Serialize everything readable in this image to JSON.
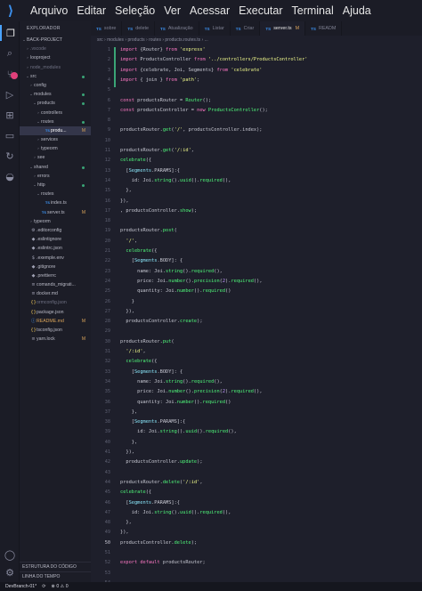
{
  "menu": [
    "Arquivo",
    "Editar",
    "Seleção",
    "Ver",
    "Acessar",
    "Executar",
    "Terminal",
    "Ajuda"
  ],
  "sidebar": {
    "title": "EXPLORADOR",
    "tree": [
      {
        "indent": 0,
        "twist": "⌄",
        "icon": "",
        "label": "BACK-PROJECT",
        "cls": "",
        "dec": ""
      },
      {
        "indent": 1,
        "twist": "›",
        "icon": "",
        "label": ".vscode",
        "cls": "dim",
        "dec": ""
      },
      {
        "indent": 1,
        "twist": "›",
        "icon": "",
        "label": "looproject",
        "cls": "",
        "dec": ""
      },
      {
        "indent": 1,
        "twist": "›",
        "icon": "",
        "label": "node_modules",
        "cls": "dim",
        "dec": ""
      },
      {
        "indent": 1,
        "twist": "⌄",
        "icon": "",
        "label": "src",
        "cls": "",
        "dec": "dot"
      },
      {
        "indent": 2,
        "twist": "›",
        "icon": "",
        "label": "config",
        "cls": "",
        "dec": ""
      },
      {
        "indent": 2,
        "twist": "⌄",
        "icon": "",
        "label": "modules",
        "cls": "",
        "dec": "dot"
      },
      {
        "indent": 3,
        "twist": "⌄",
        "icon": "",
        "label": "products",
        "cls": "",
        "dec": "dot"
      },
      {
        "indent": 4,
        "twist": "›",
        "icon": "",
        "label": "controllers",
        "cls": "",
        "dec": ""
      },
      {
        "indent": 4,
        "twist": "⌄",
        "icon": "",
        "label": "routes",
        "cls": "",
        "dec": "dot"
      },
      {
        "indent": 5,
        "twist": "",
        "icon": "TS",
        "label": "produ...",
        "cls": "sel",
        "dec": "M"
      },
      {
        "indent": 4,
        "twist": "›",
        "icon": "",
        "label": "services",
        "cls": "",
        "dec": ""
      },
      {
        "indent": 4,
        "twist": "›",
        "icon": "",
        "label": "typeorm",
        "cls": "",
        "dec": ""
      },
      {
        "indent": 3,
        "twist": "›",
        "icon": "",
        "label": "see",
        "cls": "",
        "dec": ""
      },
      {
        "indent": 2,
        "twist": "⌄",
        "icon": "",
        "label": "shared",
        "cls": "",
        "dec": "dot"
      },
      {
        "indent": 3,
        "twist": "›",
        "icon": "",
        "label": "errors",
        "cls": "",
        "dec": ""
      },
      {
        "indent": 3,
        "twist": "⌄",
        "icon": "",
        "label": "http",
        "cls": "",
        "dec": "dot"
      },
      {
        "indent": 4,
        "twist": "⌄",
        "icon": "",
        "label": "routes",
        "cls": "",
        "dec": ""
      },
      {
        "indent": 5,
        "twist": "",
        "icon": "TS",
        "label": "index.ts",
        "cls": "",
        "dec": ""
      },
      {
        "indent": 4,
        "twist": "",
        "icon": "TS",
        "label": "server.ts",
        "cls": "",
        "dec": "M"
      },
      {
        "indent": 2,
        "twist": "›",
        "icon": "",
        "label": "typeorm",
        "cls": "",
        "dec": ""
      },
      {
        "indent": 1,
        "twist": "",
        "icon": "⚙",
        "label": ".editorconfig",
        "cls": "",
        "dec": ""
      },
      {
        "indent": 1,
        "twist": "",
        "icon": "◆",
        "label": ".eslintignore",
        "cls": "",
        "dec": ""
      },
      {
        "indent": 1,
        "twist": "",
        "icon": "◆",
        "label": ".eslintrc.json",
        "cls": "",
        "dec": ""
      },
      {
        "indent": 1,
        "twist": "",
        "icon": "$",
        "label": ".exemple.env",
        "cls": "",
        "dec": ""
      },
      {
        "indent": 1,
        "twist": "",
        "icon": "◆",
        "label": ".gitignore",
        "cls": "",
        "dec": ""
      },
      {
        "indent": 1,
        "twist": "",
        "icon": "◆",
        "label": ".prettierrc",
        "cls": "",
        "dec": ""
      },
      {
        "indent": 1,
        "twist": "",
        "icon": "≡",
        "label": "comands_migrati...",
        "cls": "",
        "dec": ""
      },
      {
        "indent": 1,
        "twist": "",
        "icon": "≡",
        "label": "docker.md",
        "cls": "",
        "dec": ""
      },
      {
        "indent": 1,
        "twist": "",
        "icon": "{}",
        "label": "ormconfig.json",
        "cls": "dim",
        "dec": ""
      },
      {
        "indent": 1,
        "twist": "",
        "icon": "{}",
        "label": "package.json",
        "cls": "",
        "dec": ""
      },
      {
        "indent": 1,
        "twist": "",
        "icon": "ⓘ",
        "label": "README.md",
        "cls": "git",
        "dec": "M"
      },
      {
        "indent": 1,
        "twist": "",
        "icon": "{}",
        "label": "tsconfig.json",
        "cls": "",
        "dec": ""
      },
      {
        "indent": 1,
        "twist": "",
        "icon": "≡",
        "label": "yarn.lock",
        "cls": "",
        "dec": "M"
      }
    ],
    "outline": "ESTRUTURA DO CÓDIGO",
    "timeline": "LINHA DO TEMPO"
  },
  "tabs": [
    {
      "label": "sobre",
      "active": false,
      "mark": ""
    },
    {
      "label": "delete",
      "active": false,
      "mark": ""
    },
    {
      "label": "Atualização",
      "active": false,
      "mark": ""
    },
    {
      "label": "Listar",
      "active": false,
      "mark": ""
    },
    {
      "label": "Criar",
      "active": false,
      "mark": ""
    },
    {
      "label": "server.ts",
      "active": true,
      "mark": "M"
    },
    {
      "label": "READM",
      "active": false,
      "mark": ""
    }
  ],
  "breadcrumb": "src › modules › products › routes › products.routes.ts › ...",
  "code": [
    [
      1,
      [
        [
          "k",
          "import "
        ],
        [
          "",
          "{Router} "
        ],
        [
          "k",
          "from "
        ],
        [
          "s",
          "'express'"
        ]
      ]
    ],
    [
      2,
      [
        [
          "k",
          "import "
        ],
        [
          "",
          "ProductsController "
        ],
        [
          "k",
          "from "
        ],
        [
          "s",
          "'../controllers/ProductsController'"
        ]
      ]
    ],
    [
      3,
      [
        [
          "k",
          "import "
        ],
        [
          "",
          "{celebrate, Joi, Segments} "
        ],
        [
          "k",
          "from "
        ],
        [
          "s",
          "'celebrate'"
        ]
      ]
    ],
    [
      4,
      [
        [
          "k",
          "import "
        ],
        [
          "",
          "{ join } "
        ],
        [
          "k",
          "from "
        ],
        [
          "s",
          "'path'"
        ],
        [
          "",
          ";"
        ]
      ]
    ],
    [
      5,
      []
    ],
    [
      6,
      [
        [
          "k",
          "const "
        ],
        [
          "",
          "productsRouter = "
        ],
        [
          "f",
          "Router"
        ],
        [
          "",
          "();"
        ]
      ]
    ],
    [
      7,
      [
        [
          "k",
          "const "
        ],
        [
          "",
          "productsController = "
        ],
        [
          "k",
          "new "
        ],
        [
          "f",
          "ProductsController"
        ],
        [
          "",
          "();"
        ]
      ]
    ],
    [
      8,
      []
    ],
    [
      9,
      [
        [
          "",
          "productsRouter."
        ],
        [
          "f",
          "get"
        ],
        [
          "",
          "("
        ],
        [
          "s",
          "'/'"
        ],
        [
          "",
          ", productsController.index);"
        ]
      ]
    ],
    [
      10,
      []
    ],
    [
      11,
      [
        [
          "",
          "productsRouter."
        ],
        [
          "f",
          "get"
        ],
        [
          "",
          "("
        ],
        [
          "s",
          "'/:id'"
        ],
        [
          "",
          ","
        ]
      ]
    ],
    [
      12,
      [
        [
          "f",
          "celebrate"
        ],
        [
          "",
          "({"
        ]
      ]
    ],
    [
      13,
      [
        [
          "",
          "  ["
        ],
        [
          "c",
          "Segments"
        ],
        [
          "",
          ".PARAMS]:{"
        ]
      ]
    ],
    [
      14,
      [
        [
          "",
          "    id: Joi."
        ],
        [
          "f",
          "string"
        ],
        [
          "",
          "()."
        ],
        [
          "f",
          "uuid"
        ],
        [
          "",
          "()."
        ],
        [
          "f",
          "required"
        ],
        [
          "",
          "(),"
        ]
      ]
    ],
    [
      15,
      [
        [
          "",
          "  },"
        ]
      ]
    ],
    [
      16,
      [
        [
          "",
          "}),"
        ]
      ]
    ],
    [
      17,
      [
        [
          "",
          ", productsController."
        ],
        [
          "f",
          "show"
        ],
        [
          "",
          "); "
        ]
      ]
    ],
    [
      18,
      []
    ],
    [
      19,
      [
        [
          "",
          "productsRouter."
        ],
        [
          "f",
          "post"
        ],
        [
          "",
          "("
        ]
      ]
    ],
    [
      20,
      [
        [
          "",
          "  "
        ],
        [
          "s",
          "'/'"
        ],
        [
          "",
          ","
        ]
      ]
    ],
    [
      21,
      [
        [
          "",
          "  "
        ],
        [
          "f",
          "celebrate"
        ],
        [
          "",
          "({"
        ]
      ]
    ],
    [
      22,
      [
        [
          "",
          "    ["
        ],
        [
          "c",
          "Segments"
        ],
        [
          "",
          ".BODY]: {"
        ]
      ]
    ],
    [
      23,
      [
        [
          "",
          "      name: Joi."
        ],
        [
          "f",
          "string"
        ],
        [
          "",
          "()."
        ],
        [
          "f",
          "required"
        ],
        [
          "",
          "(),"
        ]
      ]
    ],
    [
      24,
      [
        [
          "",
          "      price: Joi."
        ],
        [
          "f",
          "number"
        ],
        [
          "",
          "()."
        ],
        [
          "f",
          "precision"
        ],
        [
          "",
          "("
        ],
        [
          "p",
          "2"
        ],
        [
          "",
          ")."
        ],
        [
          "f",
          "required"
        ],
        [
          "",
          "(),"
        ]
      ]
    ],
    [
      25,
      [
        [
          "",
          "      quantity: Joi."
        ],
        [
          "f",
          "number"
        ],
        [
          "",
          "()."
        ],
        [
          "f",
          "required"
        ],
        [
          "",
          "()"
        ]
      ]
    ],
    [
      26,
      [
        [
          "",
          "    }"
        ]
      ]
    ],
    [
      27,
      [
        [
          "",
          "  }),"
        ]
      ]
    ],
    [
      28,
      [
        [
          "",
          "  productsController."
        ],
        [
          "f",
          "create"
        ],
        [
          "",
          "); "
        ]
      ]
    ],
    [
      29,
      []
    ],
    [
      30,
      [
        [
          "",
          "productsRouter."
        ],
        [
          "f",
          "put"
        ],
        [
          "",
          "("
        ]
      ]
    ],
    [
      31,
      [
        [
          "",
          "  "
        ],
        [
          "s",
          "'/:id'"
        ],
        [
          "",
          ","
        ]
      ]
    ],
    [
      32,
      [
        [
          "",
          "  "
        ],
        [
          "f",
          "celebrate"
        ],
        [
          "",
          "({"
        ]
      ]
    ],
    [
      33,
      [
        [
          "",
          "    ["
        ],
        [
          "c",
          "Segments"
        ],
        [
          "",
          ".BODY]: {"
        ]
      ]
    ],
    [
      34,
      [
        [
          "",
          "      name: Joi."
        ],
        [
          "f",
          "string"
        ],
        [
          "",
          "()."
        ],
        [
          "f",
          "required"
        ],
        [
          "",
          "(),"
        ]
      ]
    ],
    [
      35,
      [
        [
          "",
          "      price: Joi."
        ],
        [
          "f",
          "number"
        ],
        [
          "",
          "()."
        ],
        [
          "f",
          "precision"
        ],
        [
          "",
          "("
        ],
        [
          "p",
          "2"
        ],
        [
          "",
          ")."
        ],
        [
          "f",
          "required"
        ],
        [
          "",
          "(),"
        ]
      ]
    ],
    [
      36,
      [
        [
          "",
          "      quantity: Joi."
        ],
        [
          "f",
          "number"
        ],
        [
          "",
          "()."
        ],
        [
          "f",
          "required"
        ],
        [
          "",
          "()"
        ]
      ]
    ],
    [
      37,
      [
        [
          "",
          "    },"
        ]
      ]
    ],
    [
      38,
      [
        [
          "",
          "    ["
        ],
        [
          "c",
          "Segments"
        ],
        [
          "",
          ".PARAMS]:{"
        ]
      ]
    ],
    [
      39,
      [
        [
          "",
          "      id: Joi."
        ],
        [
          "f",
          "string"
        ],
        [
          "",
          "()."
        ],
        [
          "f",
          "uuid"
        ],
        [
          "",
          "()."
        ],
        [
          "f",
          "required"
        ],
        [
          "",
          "(),"
        ]
      ]
    ],
    [
      40,
      [
        [
          "",
          "    },"
        ]
      ]
    ],
    [
      41,
      [
        [
          "",
          "  }),"
        ]
      ]
    ],
    [
      42,
      [
        [
          "",
          "  productsController."
        ],
        [
          "f",
          "update"
        ],
        [
          "",
          "); "
        ]
      ]
    ],
    [
      43,
      []
    ],
    [
      44,
      [
        [
          "",
          "productsRouter."
        ],
        [
          "f",
          "delete"
        ],
        [
          "",
          "("
        ],
        [
          "s",
          "'/:id'"
        ],
        [
          "",
          ","
        ]
      ]
    ],
    [
      45,
      [
        [
          "f",
          "celebrate"
        ],
        [
          "",
          "({"
        ]
      ]
    ],
    [
      46,
      [
        [
          "",
          "  ["
        ],
        [
          "c",
          "Segments"
        ],
        [
          "",
          ".PARAMS]:{"
        ]
      ]
    ],
    [
      47,
      [
        [
          "",
          "    id: Joi."
        ],
        [
          "f",
          "string"
        ],
        [
          "",
          "()."
        ],
        [
          "f",
          "uuid"
        ],
        [
          "",
          "()."
        ],
        [
          "f",
          "required"
        ],
        [
          "",
          "(),"
        ]
      ]
    ],
    [
      48,
      [
        [
          "",
          "  },"
        ]
      ]
    ],
    [
      49,
      [
        [
          "",
          "}),"
        ]
      ]
    ],
    [
      50,
      [
        [
          "",
          "productsController."
        ],
        [
          "f",
          "delete"
        ],
        [
          "",
          "); "
        ]
      ]
    ],
    [
      51,
      []
    ],
    [
      52,
      [
        [
          "k",
          "export default "
        ],
        [
          "",
          "productsRouter;"
        ]
      ]
    ],
    [
      53,
      []
    ],
    [
      54,
      []
    ]
  ],
  "current_line": 50,
  "status": {
    "branch": "DevBranch-01*",
    "sync": "⟳",
    "errors": "⊗ 0 ⚠ 0"
  }
}
